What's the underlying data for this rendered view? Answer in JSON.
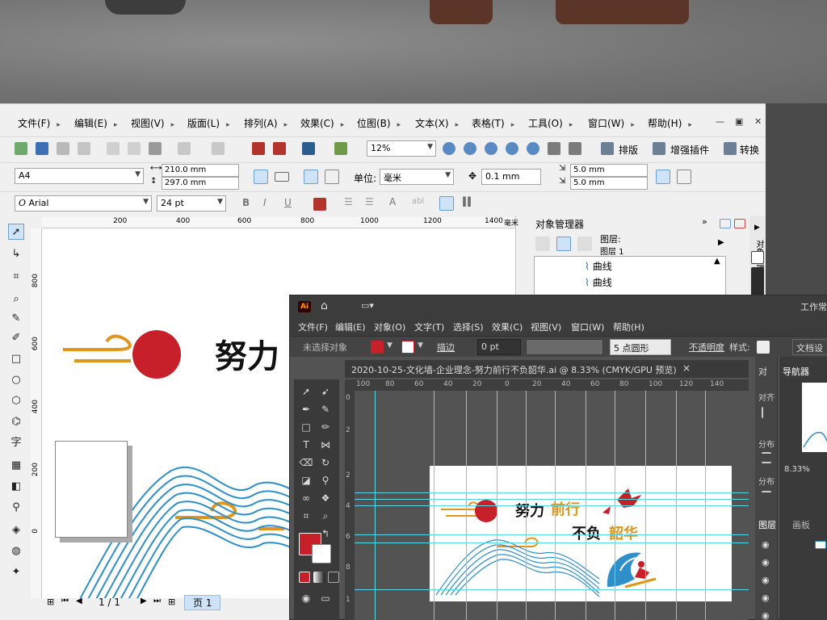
{
  "corel": {
    "menu": [
      "文件(F)",
      "编辑(E)",
      "视图(V)",
      "版面(L)",
      "排列(A)",
      "效果(C)",
      "位图(B)",
      "文本(X)",
      "表格(T)",
      "工具(O)",
      "窗口(W)",
      "帮助(H)"
    ],
    "zoom": "12%",
    "toolbar_labels": {
      "layout": "排版",
      "plugin": "增强插件",
      "convert": "转换"
    },
    "page_size": "A4",
    "width": "210.0 mm",
    "height": "297.0 mm",
    "unit_label": "单位:",
    "unit_value": "毫米",
    "nudge": "0.1 mm",
    "dup_x": "5.0 mm",
    "dup_y": "5.0 mm",
    "font_name": "Arial",
    "font_size": "24 pt",
    "ruler_h": [
      "200",
      "400",
      "600",
      "800",
      "1000",
      "1200",
      "1400"
    ],
    "ruler_unit": "毫米",
    "ruler_v": [
      "800",
      "600",
      "400",
      "200",
      "0"
    ],
    "page_counter": "1 / 1",
    "page_tab": "页 1",
    "object_manager": {
      "title": "对象管理器",
      "layer_label": "图层:",
      "layer_name": "图层 1",
      "items": [
        "曲线",
        "曲线"
      ]
    },
    "side_tab": "对象管理器"
  },
  "artwork": {
    "headline_1": "努力",
    "headline_2": "前行",
    "headline_3": "不负",
    "headline_4": "韶华",
    "accent_red": "#c8202a",
    "accent_orange": "#e0961d",
    "mountain_blue": "#2f8fc8"
  },
  "illustrator": {
    "workspace": "工作常",
    "menu": [
      "文件(F)",
      "编辑(E)",
      "对象(O)",
      "文字(T)",
      "选择(S)",
      "效果(C)",
      "视图(V)",
      "窗口(W)",
      "帮助(H)"
    ],
    "control": {
      "no_selection": "未选择对象",
      "stroke_label": "描边",
      "stroke_value": "0 pt",
      "brush": "5 点圆形",
      "opacity": "不透明度",
      "style": "样式:",
      "doc_settings": "文档设"
    },
    "tab_title": "2020-10-25-文化墙-企业理念-努力前行不负韶华.ai @ 8.33% (CMYK/GPU 预览)",
    "ruler_h": [
      "100",
      "80",
      "60",
      "40",
      "20",
      "0",
      "20",
      "40",
      "60",
      "80",
      "100",
      "120",
      "140"
    ],
    "ruler_v": [
      "0",
      "2",
      "2",
      "4",
      "6",
      "8",
      "1"
    ],
    "panels": {
      "align": "对",
      "navigator": "导航器",
      "align_objects": "对齐",
      "distribute": "分布",
      "distribute_spacing": "分布",
      "zoom": "8.33%",
      "layers": "图层",
      "artboards": "画板"
    }
  }
}
